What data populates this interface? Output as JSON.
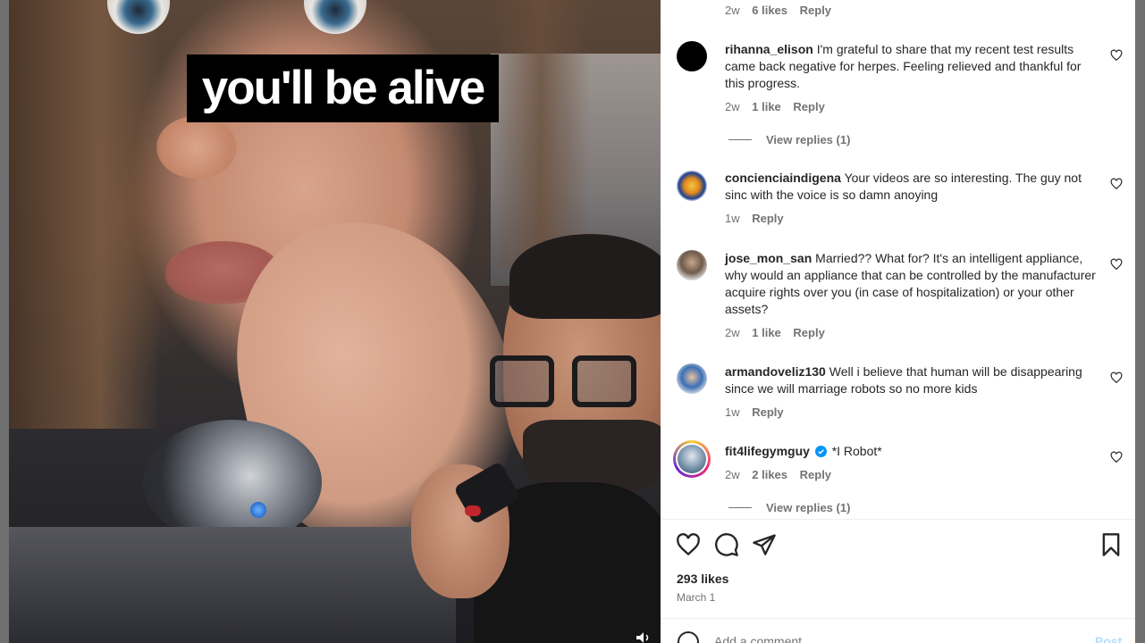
{
  "media": {
    "caption": "you'll be alive"
  },
  "top_meta": {
    "time": "2w",
    "likes": "6 likes",
    "reply": "Reply"
  },
  "comments": [
    {
      "username": "rihanna_elison",
      "text": "I'm grateful to share that my recent test results came back negative for herpes. Feeling relieved and thankful for this progress.",
      "time": "2w",
      "likes": "1 like",
      "reply": "Reply",
      "view_replies": "View replies (1)",
      "avatar": "black-circle-avatar"
    },
    {
      "username": "concienciaindigena",
      "text": "Your videos are so interesting. The guy not sinc with the voice is so damn anoying",
      "time": "1w",
      "reply": "Reply",
      "avatar": "emblem-avatar"
    },
    {
      "username": "jose_mon_san",
      "text": "Married?? What for? It's an intelligent appliance, why would an appliance that can be controlled by the manufacturer acquire rights over you (in case of hospitalization) or your other assets?",
      "time": "2w",
      "likes": "1 like",
      "reply": "Reply",
      "avatar": "portrait-avatar"
    },
    {
      "username": "armandoveliz130",
      "text": "Well i believe that human will be disappearing since we will marriage robots so no more kids",
      "time": "1w",
      "reply": "Reply",
      "avatar": "photo-avatar"
    },
    {
      "username": "fit4lifegymguy",
      "verified": true,
      "text": "*I Robot*",
      "time": "2w",
      "likes": "2 likes",
      "reply": "Reply",
      "view_replies": "View replies (1)",
      "avatar": "story-ring-avatar"
    }
  ],
  "post": {
    "likes": "293 likes",
    "date": "March 1",
    "add_comment_placeholder": "Add a comment…",
    "post_label": "Post"
  },
  "icons": {
    "like": "heart-icon",
    "comment": "speech-bubble-icon",
    "share": "paper-plane-icon",
    "save": "bookmark-icon",
    "volume": "speaker-icon",
    "emoji": "smiley-icon"
  },
  "colors": {
    "text": "#262626",
    "secondary": "#737373",
    "verified": "#0095f6",
    "post_button": "#b2dffc"
  }
}
